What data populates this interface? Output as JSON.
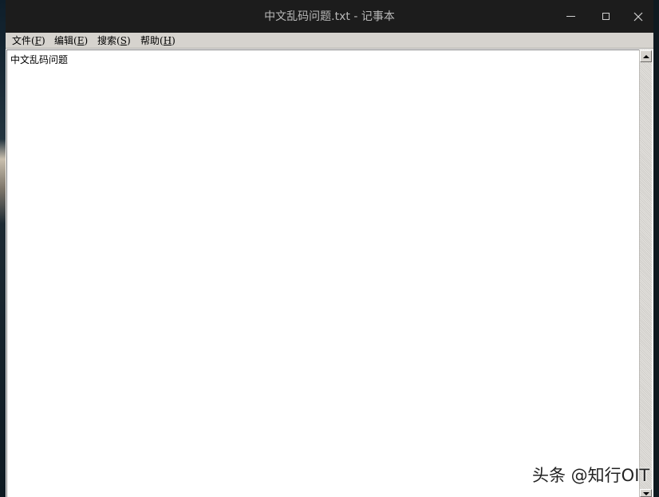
{
  "window": {
    "title": "中文乱码问题.txt - 记事本"
  },
  "titlebar_buttons": {
    "minimize": "minimize-icon",
    "maximize": "maximize-icon",
    "close": "close-icon"
  },
  "menu": {
    "items": [
      {
        "label": "文件",
        "accel_open": "(",
        "accel_key": "F",
        "accel_close": ")"
      },
      {
        "label": "编辑",
        "accel_open": "(",
        "accel_key": "E",
        "accel_close": ")"
      },
      {
        "label": "搜索",
        "accel_open": "(",
        "accel_key": "S",
        "accel_close": ")"
      },
      {
        "label": "帮助",
        "accel_open": "(",
        "accel_key": "H",
        "accel_close": ")"
      }
    ]
  },
  "editor": {
    "content": "中文乱码问题"
  },
  "scrollbar": {
    "up": "scroll-up-arrow-icon",
    "down": "scroll-down-arrow-icon"
  },
  "watermark": {
    "text": "头条 @知行OIT"
  },
  "colors": {
    "titlebar": "#1c1c1c",
    "title_text": "#b8b8b8",
    "menubar": "#d6d3ce",
    "editor_bg": "#ffffff"
  }
}
